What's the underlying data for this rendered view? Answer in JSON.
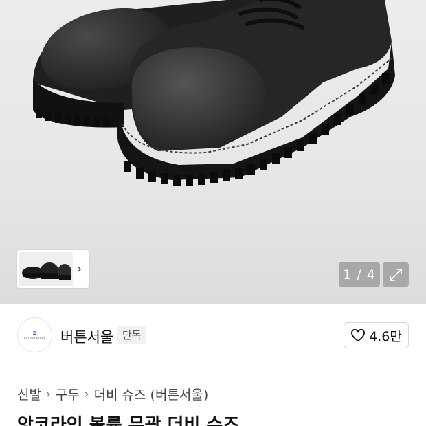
{
  "gallery": {
    "counter": "1 / 4",
    "thumb_chevron": "›"
  },
  "brand": {
    "logo_mark": "≋",
    "logo_text": "BUTTON SEOUL",
    "name": "버튼서울",
    "badge": "단독"
  },
  "like": {
    "count": "4.6만"
  },
  "breadcrumb": {
    "items": [
      "신발",
      "구두",
      "더비 슈즈 (버튼서울)"
    ],
    "separator": "›"
  },
  "product": {
    "title": "앙코라인 볼륨 무광 더비 슈즈"
  }
}
